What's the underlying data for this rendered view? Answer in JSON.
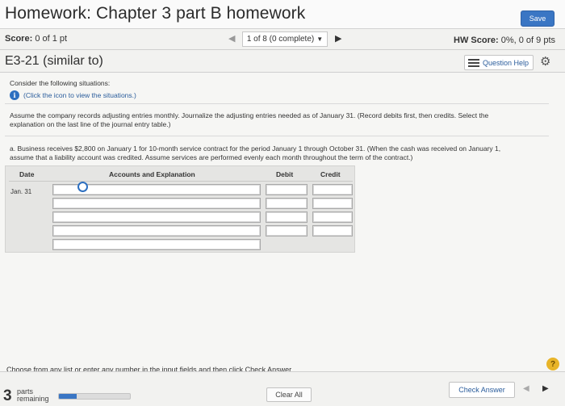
{
  "header": {
    "title": "Homework: Chapter 3 part B homework",
    "save_label": "Save"
  },
  "score": {
    "label": "Score:",
    "value": "0 of 1 pt",
    "nav_prev": "◀",
    "nav_select": "1 of 8 (0 complete)",
    "nav_select_caret": "▼",
    "nav_next": "▶",
    "hw_label": "HW Score:",
    "hw_value": "0%, 0 of 9 pts"
  },
  "question": {
    "title": "E3-21 (similar to)",
    "help_label": "Question Help",
    "gear": "⚙"
  },
  "content": {
    "consider": "Consider the following situations:",
    "info_icon": "i",
    "info_link": "(Click the icon to view the situations.)",
    "instructions_1": "Assume the company records adjusting entries monthly. Journalize the adjusting entries needed as of January 31. (Record debits first, then credits. Select the",
    "instructions_2": "explanation on the last line of the journal entry table.)",
    "part_a_1": "a. Business receives $2,800 on January 1 for 10-month service contract for the period January 1 through October 31. (When the cash was received on January 1,",
    "part_a_2": "assume that a liability account was credited. Assume services are performed evenly each month throughout the term of the contract.)",
    "bottom_instruction": "Choose from any list or enter any number in the input fields and then click Check Answer."
  },
  "journal": {
    "headers": [
      "Date",
      "Accounts and Explanation",
      "Debit",
      "Credit"
    ],
    "date": "Jan. 31"
  },
  "footer": {
    "parts_num": "3",
    "parts_label_1": "parts",
    "parts_label_2": "remaining",
    "progress": 0.25,
    "clear_label": "Clear All",
    "check_label": "Check Answer",
    "prev": "◀",
    "next": "▶",
    "help": "?"
  },
  "colors": {
    "accent": "#3a76c4",
    "help": "#e8b428"
  }
}
